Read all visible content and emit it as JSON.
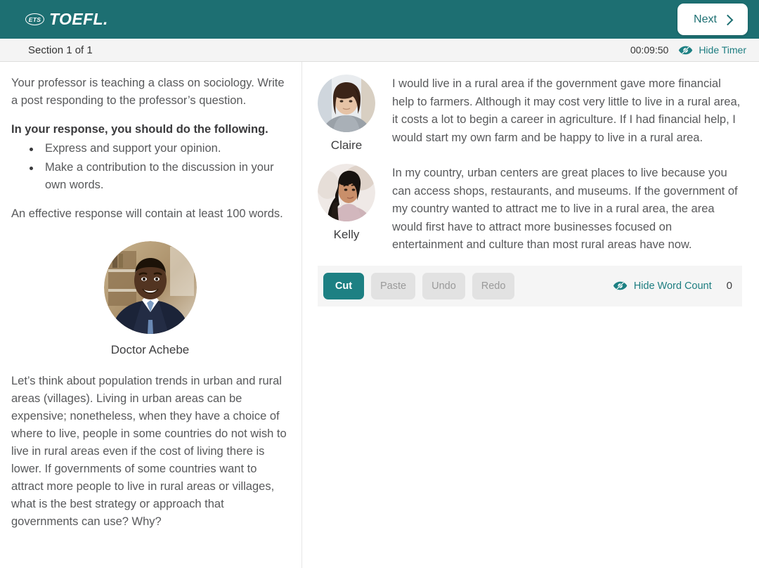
{
  "header": {
    "brand_ets": "ETS",
    "brand_name": "TOEFL.",
    "next_label": "Next",
    "next_icon": "chevron-right-icon",
    "logo_icon": "ets-oval-logo-icon"
  },
  "sectionbar": {
    "section_label": "Section 1 of 1",
    "timer_value": "00:09:50",
    "hide_timer_label": "Hide Timer",
    "hide_timer_icon": "eye-slash-icon"
  },
  "instructions": {
    "intro": "Your professor is teaching a class on sociology. Write a post responding to the professor’s question.",
    "directive": "In your response, you should do the following.",
    "bullets": [
      "Express and support your opinion.",
      "Make a contribution to the discussion in your own words."
    ],
    "length_note": "An effective response will contain at least 100 words."
  },
  "professor": {
    "name": "Doctor Achebe",
    "avatar_icon": "professor-avatar",
    "question": "Let’s think about population trends in urban and rural areas (villages). Living in urban areas can be expensive; nonetheless, when they have a choice of where to live, people in some countries do not wish to live in rural areas even if the cost of living there is lower. If governments of some countries want to attract more people to live in rural areas or villages, what is the best strategy or approach that governments can use? Why?"
  },
  "discussion": {
    "posts": [
      {
        "name": "Claire",
        "avatar_icon": "claire-avatar",
        "text": "I would live in a rural area if the government gave more financial help to farmers. Although it may cost very little to live in a rural area, it costs a lot to begin a career in agriculture. If I had financial help, I would start my own farm and be happy to live in a rural area."
      },
      {
        "name": "Kelly",
        "avatar_icon": "kelly-avatar",
        "text": "In my country, urban centers are great places to live because you can access shops, restaurants, and museums. If the government of my country wanted to attract me to live in a rural area, the area would first have to attract more businesses focused on entertainment and culture than most rural areas have now."
      }
    ]
  },
  "editor_toolbar": {
    "cut_label": "Cut",
    "paste_label": "Paste",
    "undo_label": "Undo",
    "redo_label": "Redo",
    "hide_word_count_label": "Hide Word Count",
    "hide_word_count_icon": "eye-slash-icon",
    "word_count": "0"
  },
  "colors": {
    "brand_teal": "#1d6f72",
    "accent_teal": "#1d8083",
    "link_teal": "#1d7d80",
    "body_text": "#58595b",
    "toolbar_bg": "#f5f5f5",
    "disabled_btn": "#e2e2e2"
  }
}
